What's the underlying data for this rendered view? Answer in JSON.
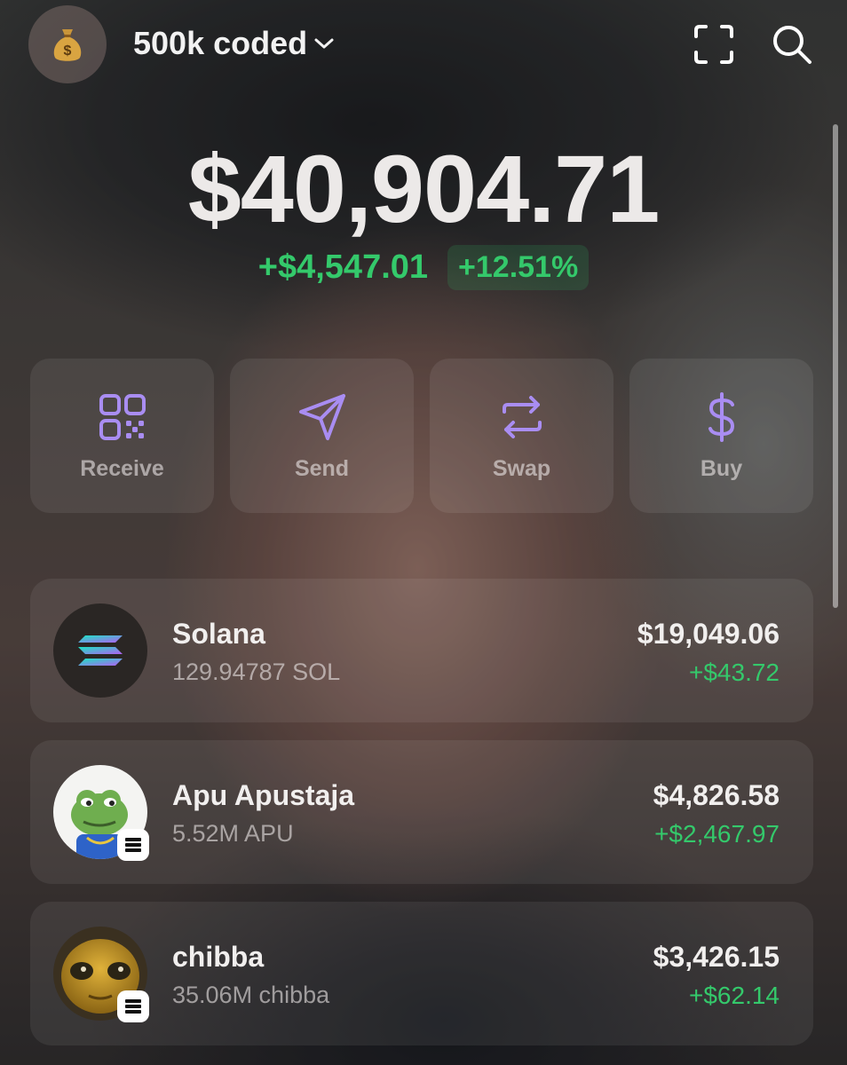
{
  "header": {
    "account_name": "500k coded",
    "avatar_icon": "money-bag-icon",
    "scan_icon": "scan-icon",
    "search_icon": "search-icon"
  },
  "balance": {
    "total": "$40,904.71",
    "change_abs": "+$4,547.01",
    "change_pct": "+12.51%"
  },
  "actions": [
    {
      "label": "Receive",
      "icon": "qr-code-icon"
    },
    {
      "label": "Send",
      "icon": "send-icon"
    },
    {
      "label": "Swap",
      "icon": "swap-icon"
    },
    {
      "label": "Buy",
      "icon": "dollar-icon"
    }
  ],
  "tokens": [
    {
      "name": "Solana",
      "amount": "129.94787 SOL",
      "value": "$19,049.06",
      "change": "+$43.72"
    },
    {
      "name": "Apu Apustaja",
      "amount": "5.52M APU",
      "value": "$4,826.58",
      "change": "+$2,467.97"
    },
    {
      "name": "chibba",
      "amount": "35.06M chibba",
      "value": "$3,426.15",
      "change": "+$62.14"
    }
  ],
  "colors": {
    "positive": "#34c96b",
    "accent": "#a98df2"
  }
}
